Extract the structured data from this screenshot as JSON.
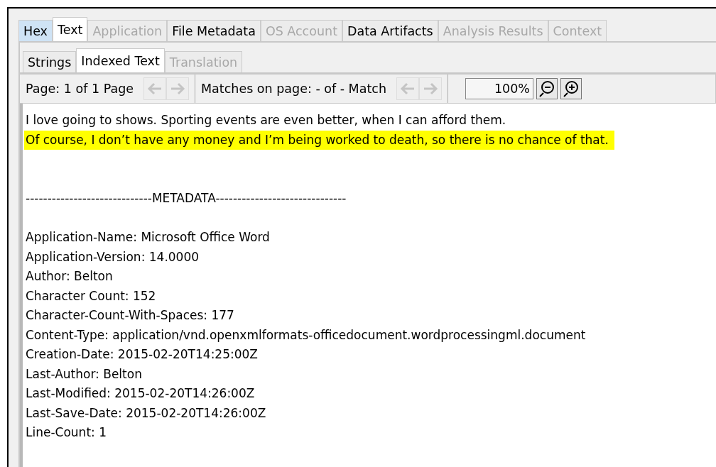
{
  "tabs": [
    {
      "label": "Hex",
      "selected": false,
      "disabled": false,
      "hovered": true
    },
    {
      "label": "Text",
      "selected": true,
      "disabled": false,
      "hovered": false
    },
    {
      "label": "Application",
      "selected": false,
      "disabled": true,
      "hovered": false
    },
    {
      "label": "File Metadata",
      "selected": false,
      "disabled": false,
      "hovered": false
    },
    {
      "label": "OS Account",
      "selected": false,
      "disabled": true,
      "hovered": false
    },
    {
      "label": "Data Artifacts",
      "selected": false,
      "disabled": false,
      "hovered": false
    },
    {
      "label": "Analysis Results",
      "selected": false,
      "disabled": true,
      "hovered": false
    },
    {
      "label": "Context",
      "selected": false,
      "disabled": true,
      "hovered": false
    }
  ],
  "subtabs": [
    {
      "label": "Strings",
      "selected": false,
      "disabled": false
    },
    {
      "label": "Indexed Text",
      "selected": true,
      "disabled": false
    },
    {
      "label": "Translation",
      "selected": false,
      "disabled": true
    }
  ],
  "toolbar": {
    "page_label": "Page:  1  of  1  Page",
    "page_nav_disabled": true,
    "matches_label": "Matches on page:  -  of  -  Match",
    "match_nav_disabled": true,
    "zoom": "100%"
  },
  "content": [
    {
      "kind": "text",
      "text": "I love going to shows.  Sporting events are even better, when I can afford them.",
      "highlighted": false
    },
    {
      "kind": "text",
      "text": "Of course, I don’t have any money and I’m being worked to death, so there is no chance of that.",
      "highlighted": true
    },
    {
      "kind": "heading",
      "text": "-----------------------------METADATA------------------------------",
      "highlighted": false
    },
    {
      "kind": "text",
      "text": "Application-Name: Microsoft Office Word",
      "highlighted": false
    },
    {
      "kind": "text",
      "text": "Application-Version: 14.0000",
      "highlighted": false
    },
    {
      "kind": "text",
      "text": "Author: Belton",
      "highlighted": false
    },
    {
      "kind": "text",
      "text": "Character Count: 152",
      "highlighted": false
    },
    {
      "kind": "text",
      "text": "Character-Count-With-Spaces: 177",
      "highlighted": false
    },
    {
      "kind": "text",
      "text": "Content-Type: application/vnd.openxmlformats-officedocument.wordprocessingml.document",
      "highlighted": false
    },
    {
      "kind": "text",
      "text": "Creation-Date: 2015-02-20T14:25:00Z",
      "highlighted": false
    },
    {
      "kind": "text",
      "text": "Last-Author: Belton",
      "highlighted": false
    },
    {
      "kind": "text",
      "text": "Last-Modified: 2015-02-20T14:26:00Z",
      "highlighted": false
    },
    {
      "kind": "text",
      "text": "Last-Save-Date: 2015-02-20T14:26:00Z",
      "highlighted": false
    },
    {
      "kind": "text",
      "text": "Line-Count: 1",
      "highlighted": false
    }
  ]
}
